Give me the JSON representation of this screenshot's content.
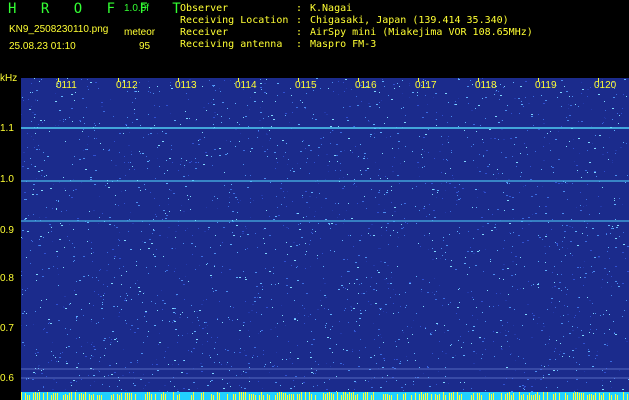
{
  "header": {
    "brand": "H R O F F T",
    "version": "1.0.0f",
    "filename": "KN9_2508230110.png",
    "mode": "meteor",
    "timestamp": "25.08.23 01:10",
    "count": "95"
  },
  "info": [
    {
      "key": "Observer",
      "value": "K.Nagai"
    },
    {
      "key": "Receiving Location",
      "value": "Chigasaki, Japan (139.414 35.340)"
    },
    {
      "key": "Receiver",
      "value": "AirSpy mini (Miakejima VOR 108.65MHz)"
    },
    {
      "key": "Receiving antenna",
      "value": "Maspro FM-3"
    }
  ],
  "axis": {
    "unit": "kHz",
    "y_labels": [
      "1.1",
      "1.0",
      "0.9",
      "0.8",
      "0.7",
      "0.6"
    ],
    "time_labels": [
      "0111",
      "0112",
      "0113",
      "0114",
      "0115",
      "0116",
      "0117",
      "0118",
      "0119",
      "0120"
    ]
  },
  "colors": {
    "background": "#1a2a8a",
    "signal": "#55e0ff",
    "text_yellow": "#ffff33",
    "text_green": "#33ff33"
  }
}
